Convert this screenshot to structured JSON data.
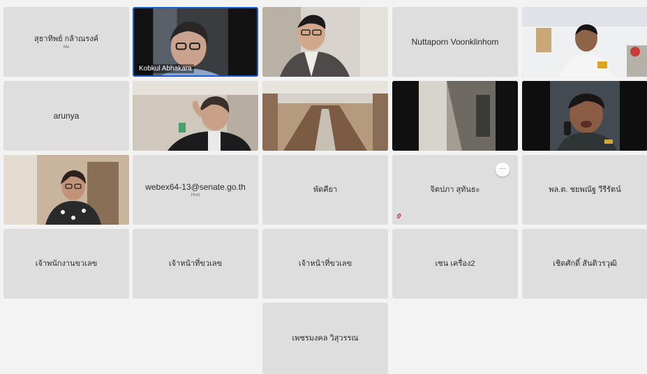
{
  "meeting": {
    "participants": [
      {
        "name": "สุธาทิพย์ กล้าณรงค์",
        "role": "Me"
      },
      {
        "name": "Kobkul Abhakara",
        "video": true
      },
      {
        "name": "",
        "video": true
      },
      {
        "name": "Nuttaporn Voonklinhom"
      },
      {
        "name": "",
        "video": true
      },
      {
        "name": "arunya"
      },
      {
        "name": "",
        "video": true
      },
      {
        "name": "",
        "video": true
      },
      {
        "name": "",
        "video": true
      },
      {
        "name": "",
        "video": true
      },
      {
        "name": "",
        "video": true
      },
      {
        "name": "webex64-13@senate.go.th",
        "role": "Host"
      },
      {
        "name": "พัดคียา"
      },
      {
        "name": "จิตปภา สุทันธะ",
        "more_label": "···",
        "hand_icon": "raised-hand-icon"
      },
      {
        "name": "พล.ต. ชยพณัฐ วีรีรัตน์"
      },
      {
        "name": "เจ้าพนักงานขวเลข"
      },
      {
        "name": "เจ้าหน้าที่ขวเลข"
      },
      {
        "name": "เจ้าหน้าที่ขวเลข"
      },
      {
        "name": "เซน เครื่อง2"
      },
      {
        "name": "เชิดศักดิ์ สันติวรวุฒิ"
      },
      {
        "name": "เพชรมงคล วิสุวรรณ"
      }
    ]
  },
  "colors": {
    "tile_bg": "#dedede",
    "stage_bg": "#f3f3f3",
    "active_speaker_border": "#1b5fd6"
  }
}
